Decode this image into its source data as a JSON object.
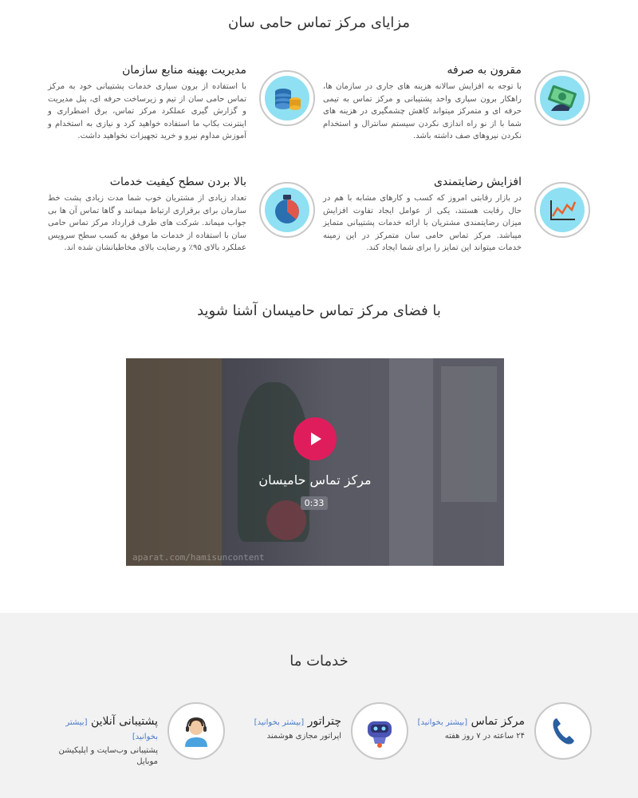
{
  "benefits": {
    "title": "مزایای مرکز تماس حامی سان",
    "items": [
      {
        "title": "مقرون به صرفه",
        "body": "با توجه به افزایش سالانه هزینه های جاری در سازمان ها، راهکار برون سپاری واحد پشتیبانی و مرکز تماس به تیمی حرفه ای و متمرکز میتواند کاهش چشمگیری در هزینه های شما با از نو راه اندازی نکردن سیستم سانترال و استخدام نکردن نیروهای صف داشته باشد.",
        "icon": "money-hand-icon"
      },
      {
        "title": "مدیریت بهینه منابع سازمان",
        "body": "با استفاده از برون سپاری خدمات پشتیبانی خود به مرکز تماس حامی سان از تیم و زیرساخت حرفه ای، پنل مدیریت و گزارش گیری عملکرد مرکز تماس، برق اضطراری و اینترنت بکاپ ما استفاده خواهید کرد و نیازی به استخدام و آموزش مداوم نیرو و خرید تجهیزات نخواهید داشت.",
        "icon": "database-coins-icon"
      },
      {
        "title": "افزایش رضایتمندی",
        "body": "در بازار رقابتی امروز که کسب و کارهای مشابه با هم در حال رقابت هستند، یکی از عوامل ایجاد تفاوت افزایش میزان رضایتمندی مشتریان با ارائه خدمات پشتیبانی متمایز میباشد. مرکز تماس حامی سان متمرکز در این زمینه خدمات میتواند این تمایز را برای شما ایجاد کند.",
        "icon": "line-chart-icon"
      },
      {
        "title": "بالا بردن سطح کیفیت خدمات",
        "body": "تعداد زیادی از مشتریان خوب شما مدت زیادی پشت خط سازمان برای برقراری ارتباط میمانند و گاها تماس آن ها بی جواب میماند. شرکت های طرف قرارداد مرکز تماس حامی سان با استفاده از خدمات ما موفق به کسب سطح سرویس عملکرد بالای ۹۵٪ و رضایت بالای مخاطبانشان شده اند.",
        "icon": "pie-quality-icon"
      }
    ]
  },
  "video_section": {
    "title": "با فضای مرکز تماس حامیسان آشنا شوید",
    "video_title": "مرکز تماس حامیسان",
    "duration": "0:33",
    "watermark": "aparat.com/hamisuncontent"
  },
  "services": {
    "title": "خدمات ما",
    "more_label": "[بیشتر بخوانید]",
    "items": [
      {
        "name": "مرکز تماس",
        "desc": "۲۴ ساعته در ۷ روز هفته",
        "icon": "phone-handset-icon"
      },
      {
        "name": "چتراتور",
        "desc": "اپراتور مجازی هوشمند",
        "icon": "robot-icon"
      },
      {
        "name": "پشتیبانی آنلاین",
        "desc": "پشتیبانی وب‌سایت و اپلیکیشن موبایل",
        "icon": "support-agent-icon"
      }
    ]
  },
  "colors": {
    "icon_bg": "#8fe0f2",
    "play_button": "#e01d5c",
    "link": "#4a7cc7",
    "band": "#f2f2f3"
  }
}
